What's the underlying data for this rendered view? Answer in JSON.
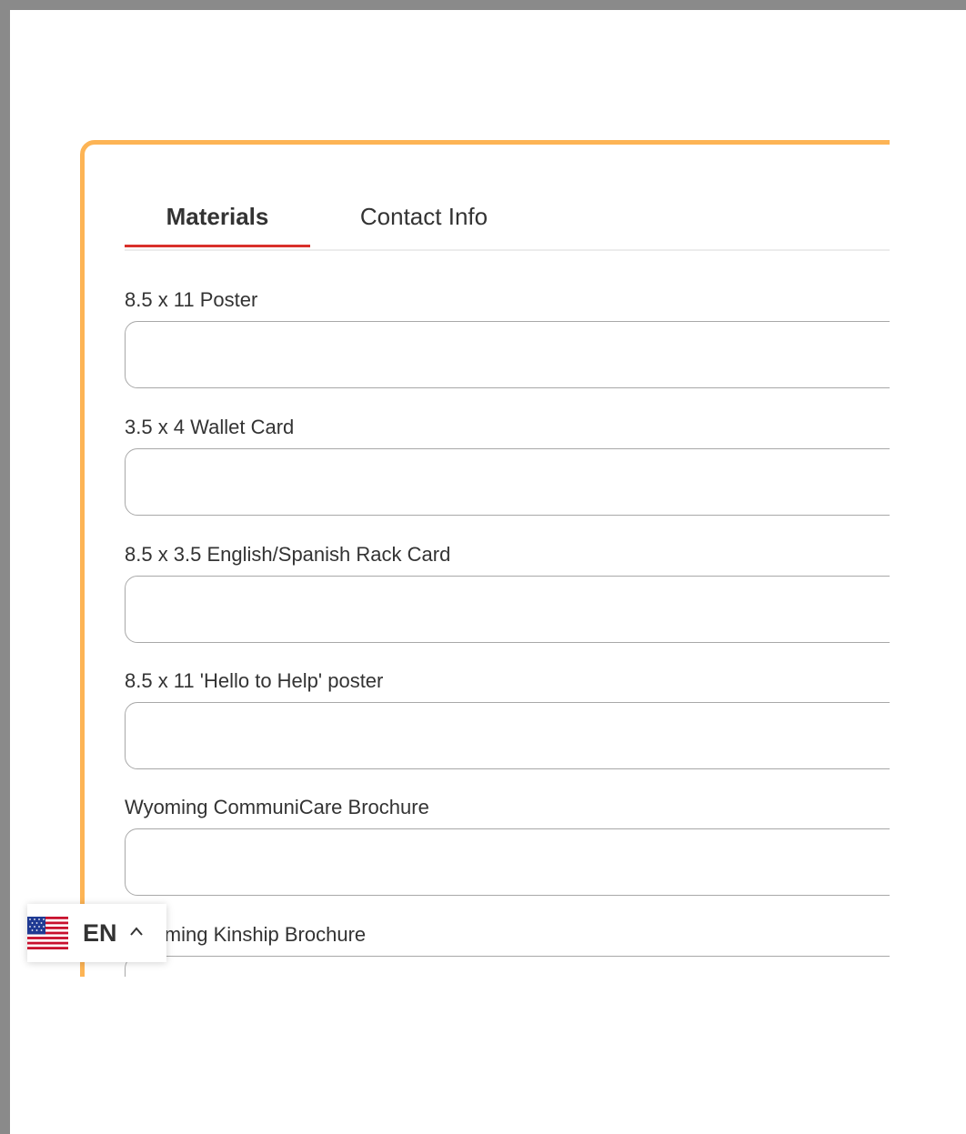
{
  "tabs": [
    {
      "label": "Materials",
      "active": true
    },
    {
      "label": "Contact Info",
      "active": false
    }
  ],
  "fields": [
    {
      "label": "8.5 x 11 Poster",
      "value": ""
    },
    {
      "label": "3.5 x 4 Wallet Card",
      "value": ""
    },
    {
      "label": "8.5 x 3.5 English/Spanish Rack Card",
      "value": ""
    },
    {
      "label": "8.5 x 11 'Hello to Help' poster",
      "value": ""
    },
    {
      "label": "Wyoming CommuniCare Brochure",
      "value": ""
    },
    {
      "label": "Wyoming Kinship Brochure",
      "value": ""
    }
  ],
  "language": {
    "code": "EN",
    "flag": "us-flag-icon"
  },
  "colors": {
    "card_border": "#fdb455",
    "tab_accent": "#d9302a"
  }
}
